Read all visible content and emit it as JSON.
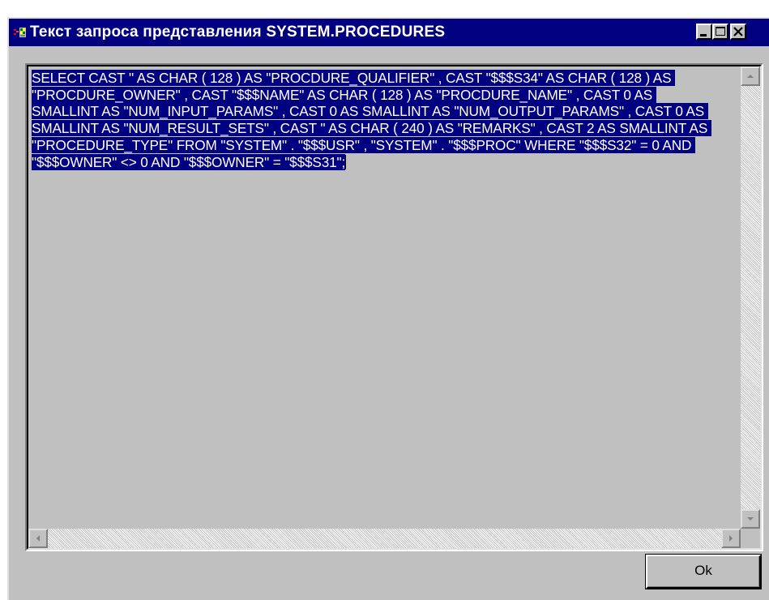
{
  "window": {
    "title": "Текст запроса представления  SYSTEM.PROCEDURES",
    "icon": "app-icon",
    "controls": [
      "minimize-icon",
      "maximize-icon",
      "close-icon"
    ]
  },
  "editor": {
    "query_text": "SELECT CAST '' AS CHAR ( 128 ) AS \"PROCDURE_QUALIFIER\" , CAST \"$$$S34\" AS CHAR ( 128 ) AS \"PROCDURE_OWNER\" , CAST \"$$$NAME\" AS CHAR ( 128 ) AS \"PROCDURE_NAME\" , CAST 0 AS SMALLINT AS \"NUM_INPUT_PARAMS\" , CAST 0 AS SMALLINT AS \"NUM_OUTPUT_PARAMS\" , CAST 0 AS SMALLINT AS \"NUM_RESULT_SETS\" , CAST '' AS CHAR ( 240 ) AS \"REMARKS\" , CAST 2 AS SMALLINT AS \"PROCEDURE_TYPE\" FROM \"SYSTEM\" . \"$$$USR\" , \"SYSTEM\" . \"$$$PROC\" WHERE \"$$$S32\" = 0 AND \"$$$OWNER\" <> 0 AND \"$$$OWNER\" = \"$$$S31\";",
    "selection_color": "#000080"
  },
  "buttons": {
    "ok_label": "Ok"
  },
  "colors": {
    "face": "#c0c0c0",
    "titlebar": "#000080",
    "title_text": "#ffffff"
  }
}
